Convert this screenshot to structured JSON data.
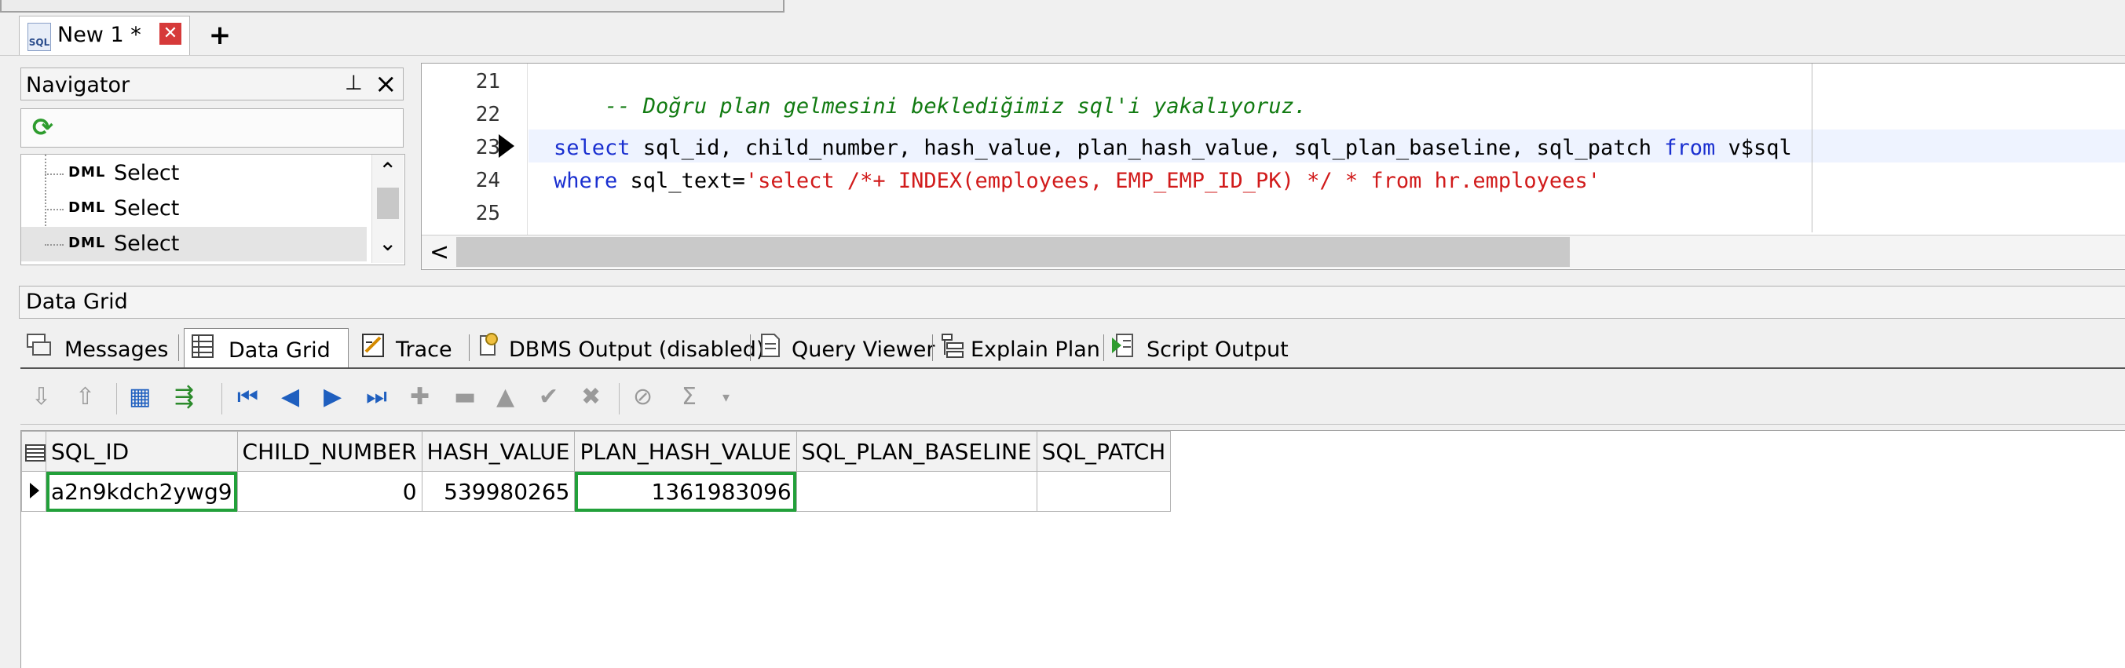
{
  "doc_tab": {
    "icon": "sql-file-icon",
    "icon_text": "SQL",
    "title": "New 1 *",
    "close": "✕",
    "new_tab": "+"
  },
  "navigator": {
    "title": "Navigator",
    "pin": "⊥",
    "close": "×",
    "refresh": "⟳",
    "items": [
      {
        "kind": "DML",
        "label": "Select"
      },
      {
        "kind": "DML",
        "label": "Select"
      },
      {
        "kind": "DML",
        "label": "Select"
      }
    ],
    "scroll_up": "⌃",
    "scroll_down": "⌄"
  },
  "editor": {
    "lines": [
      "21",
      "22",
      "23",
      "24",
      "25"
    ],
    "comment": "-- Doğru plan gelmesini beklediğimiz sql'i yakalıyoruz.",
    "line23_kw1": "select",
    "line23_mid": " sql_id, child_number, hash_value, plan_hash_value, sql_plan_baseline, sql_patch ",
    "line23_kw2": "from",
    "line23_end": " v$sql",
    "line24_kw": "where",
    "line24_mid": " sql_text=",
    "line24_str": "'select /*+ INDEX(employees, EMP_EMP_ID_PK) */ * from hr.employees'",
    "hscroll_left": "<"
  },
  "data_grid_header": "Data Grid",
  "output_tabs": [
    {
      "label": "Messages",
      "icon": "messages-icon"
    },
    {
      "label": "Data Grid",
      "icon": "data-grid-icon"
    },
    {
      "label": "Trace",
      "icon": "trace-icon"
    },
    {
      "label": "DBMS Output (disabled)",
      "icon": "dbms-output-icon"
    },
    {
      "label": "Query Viewer",
      "icon": "query-viewer-icon"
    },
    {
      "label": "Explain Plan",
      "icon": "explain-plan-icon"
    },
    {
      "label": "Script Output",
      "icon": "script-output-icon"
    }
  ],
  "active_output_tab": "Data Grid",
  "grid": {
    "columns": [
      "SQL_ID",
      "CHILD_NUMBER",
      "HASH_VALUE",
      "PLAN_HASH_VALUE",
      "SQL_PLAN_BASELINE",
      "SQL_PATCH"
    ],
    "rows": [
      [
        "a2n9kdch2ywg9",
        "0",
        "539980265",
        "1361983096",
        "",
        ""
      ]
    ],
    "highlighted_cells": [
      "SQL_ID",
      "PLAN_HASH_VALUE"
    ],
    "highlight_color": "#22a03a"
  },
  "colors": {
    "comment": "#127b12",
    "keyword": "#1a2fd0",
    "string": "#d11b1b"
  }
}
